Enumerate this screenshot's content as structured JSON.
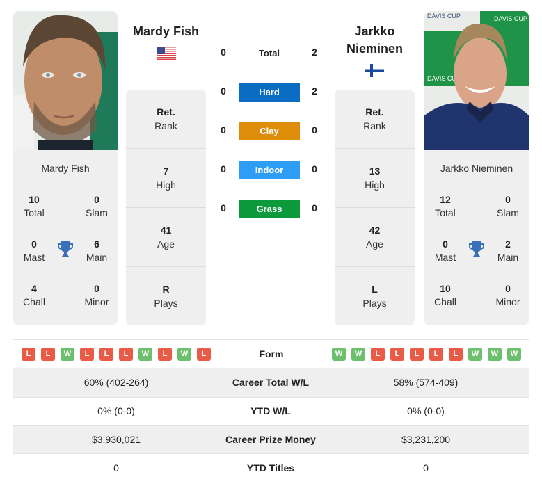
{
  "players": [
    {
      "name": "Mardy Fish",
      "country_flag": "usa-flag",
      "card_name": "Mardy Fish",
      "titles": {
        "total": "10",
        "slam": "0",
        "mast": "0",
        "main": "6",
        "chall": "4",
        "minor": "0"
      },
      "stats": [
        {
          "value": "Ret.",
          "label": "Rank"
        },
        {
          "value": "7",
          "label": "High"
        },
        {
          "value": "41",
          "label": "Age"
        },
        {
          "value": "R",
          "label": "Plays"
        }
      ],
      "form": [
        "L",
        "L",
        "W",
        "L",
        "L",
        "L",
        "W",
        "L",
        "W",
        "L"
      ]
    },
    {
      "name": "Jarkko Nieminen",
      "country_flag": "finland-flag",
      "card_name": "Jarkko Nieminen",
      "titles": {
        "total": "12",
        "slam": "0",
        "mast": "0",
        "main": "2",
        "chall": "10",
        "minor": "0"
      },
      "stats": [
        {
          "value": "Ret.",
          "label": "Rank"
        },
        {
          "value": "13",
          "label": "High"
        },
        {
          "value": "42",
          "label": "Age"
        },
        {
          "value": "L",
          "label": "Plays"
        }
      ],
      "form": [
        "W",
        "W",
        "L",
        "L",
        "L",
        "L",
        "L",
        "W",
        "W",
        "W"
      ]
    }
  ],
  "title_labels": {
    "total": "Total",
    "slam": "Slam",
    "mast": "Mast",
    "main": "Main",
    "chall": "Chall",
    "minor": "Minor"
  },
  "h2h": [
    {
      "label": "Total",
      "left": "0",
      "right": "2",
      "color": ""
    },
    {
      "label": "Hard",
      "left": "0",
      "right": "2",
      "color": "#0a6cc2"
    },
    {
      "label": "Clay",
      "left": "0",
      "right": "0",
      "color": "#dd8d0a"
    },
    {
      "label": "Indoor",
      "left": "0",
      "right": "0",
      "color": "#2e9df5"
    },
    {
      "label": "Grass",
      "left": "0",
      "right": "0",
      "color": "#0d9a3d"
    }
  ],
  "form_label": "Form",
  "comparison": [
    {
      "left": "60% (402-264)",
      "label": "Career Total W/L",
      "right": "58% (574-409)"
    },
    {
      "left": "0% (0-0)",
      "label": "YTD W/L",
      "right": "0% (0-0)"
    },
    {
      "left": "$3,930,021",
      "label": "Career Prize Money",
      "right": "$3,231,200"
    },
    {
      "left": "0",
      "label": "YTD Titles",
      "right": "0"
    }
  ],
  "colors": {
    "loss": "#ea5b47",
    "win": "#6cbf6c",
    "trophy": "#3a6fba",
    "card_bg": "#efefef"
  }
}
